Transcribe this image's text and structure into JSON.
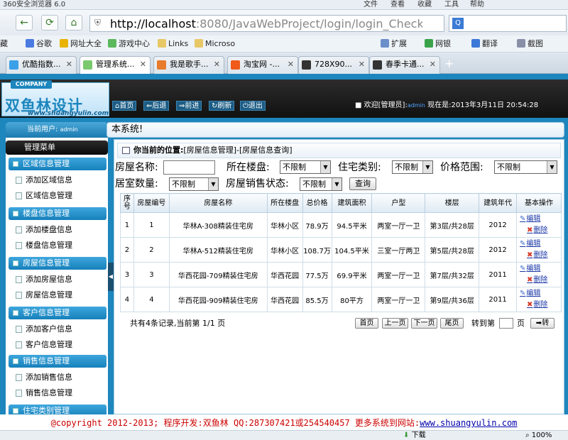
{
  "browser": {
    "title": "360安全浏览器 6.0",
    "menu": [
      "文件",
      "查看",
      "收藏",
      "工具",
      "帮助"
    ],
    "url_host": "http://localhost",
    "url_rest": ":8080/JavaWebProject/login/login_CheckLogin.ac",
    "bookmarks": [
      "藏",
      "谷歌",
      "网址大全",
      "游戏中心",
      "Links",
      "Microso",
      "扩展",
      "网银",
      "翻译",
      "截图"
    ],
    "tabs": [
      "优酷指数...",
      "管理系统...",
      "我是歌手...",
      "淘宝网 -...",
      "728X90...",
      "春季卡通..."
    ],
    "status": [
      "下载",
      "100%"
    ]
  },
  "site": {
    "company": "COMPANY",
    "logo_text": "双鱼林设计",
    "logo_url": "www.shuangyulin.com",
    "nav": [
      "首页",
      "后退",
      "前进",
      "刷新",
      "退出"
    ],
    "welcome": "欢迎[管理员]:",
    "welcome_user": "admin",
    "now_label": "现在是:",
    "datetime": "2013年3月11日 20:54:28"
  },
  "sidebar": {
    "current_user_label": "当前用户:",
    "current_user": "admin",
    "menu_title": "管理菜单",
    "groups": [
      {
        "title": "区域信息管理",
        "items": [
          "添加区域信息",
          "区域信息管理"
        ]
      },
      {
        "title": "楼盘信息管理",
        "items": [
          "添加楼盘信息",
          "楼盘信息管理"
        ]
      },
      {
        "title": "房屋信息管理",
        "items": [
          "添加房屋信息",
          "房屋信息管理"
        ]
      },
      {
        "title": "客户信息管理",
        "items": [
          "添加客户信息",
          "客户信息管理"
        ]
      },
      {
        "title": "销售信息管理",
        "items": [
          "添加销售信息",
          "销售信息管理"
        ]
      },
      {
        "title": "住宅类别管理",
        "items": []
      }
    ]
  },
  "main": {
    "bar_title": "本系统!",
    "location_label": "你当前的位置:",
    "location_path": "[房屋信息管理]-[房屋信息查询]",
    "filters": {
      "name_label": "房屋名称:",
      "name_value": "",
      "building_label": "所在楼盘:",
      "building_value": "不限制",
      "type_label": "住宅类别:",
      "type_value": "不限制",
      "price_label": "价格范围:",
      "price_value": "不限制",
      "rooms_label": "居室数量:",
      "rooms_value": "不限制",
      "sale_label": "房屋销售状态:",
      "sale_value": "不限制",
      "query_button": "查询"
    },
    "table": {
      "headers": [
        "序号",
        "房屋编号",
        "房屋名称",
        "所在楼盘",
        "总价格",
        "建筑面积",
        "户型",
        "楼层",
        "建筑年代",
        "基本操作"
      ],
      "rows": [
        [
          "1",
          "1",
          "华林A-308精装住宅房",
          "华林小区",
          "78.9万",
          "94.5平米",
          "两室一厅一卫",
          "第3层/共28层",
          "2012"
        ],
        [
          "2",
          "2",
          "华林A-512精装住宅房",
          "华林小区",
          "108.7万",
          "104.5平米",
          "三室一厅两卫",
          "第5层/共28层",
          "2012"
        ],
        [
          "3",
          "3",
          "华西花园-709精装住宅房",
          "华西花园",
          "77.5万",
          "69.9平米",
          "两室一厅一卫",
          "第7层/共32层",
          "2011"
        ],
        [
          "4",
          "4",
          "华西花园-909精装住宅房",
          "华西花园",
          "85.5万",
          "80平方",
          "两室一厅一卫",
          "第9层/共36层",
          "2011"
        ]
      ],
      "edit_label": "编辑",
      "delete_label": "删除"
    },
    "pager": {
      "summary": "共有4条记录,当前第 1/1 页",
      "first": "首页",
      "prev": "上一页",
      "next": "下一页",
      "last": "尾页",
      "goto_label": "转到第",
      "page_unit": "页",
      "go_button": "转"
    }
  },
  "footer": {
    "text": "@copyright 2012-2013; 程序开发:双鱼林  QQ:287307421或254540457  更多系统到网站:",
    "link": "www.shuangyulin.com"
  }
}
